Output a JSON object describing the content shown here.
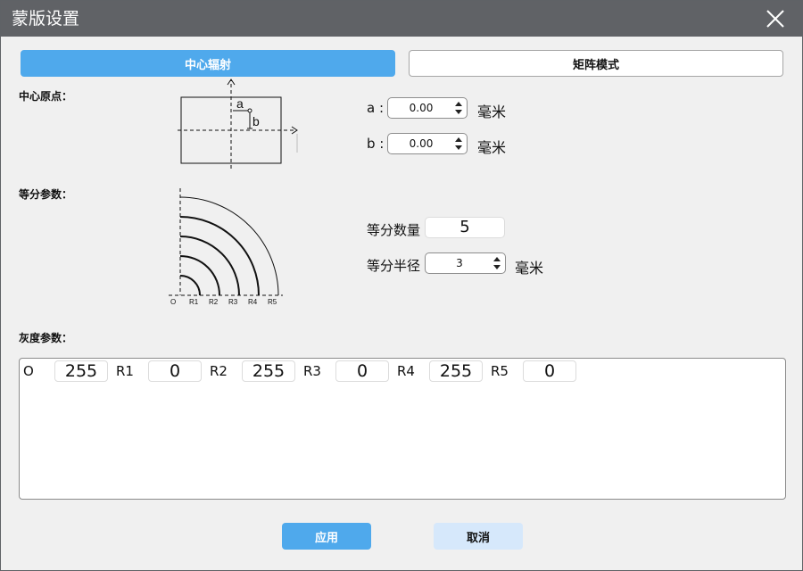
{
  "window": {
    "title": "蒙版设置"
  },
  "tabs": [
    {
      "label": "中心辐射",
      "active": true
    },
    {
      "label": "矩阵模式",
      "active": false
    }
  ],
  "center_origin": {
    "label": "中心原点：",
    "diagram": {
      "a_label": "a",
      "b_label": "b"
    },
    "a": {
      "label": "a :",
      "value": "0.00",
      "unit": "毫米"
    },
    "b": {
      "label": "b :",
      "value": "0.00",
      "unit": "毫米"
    }
  },
  "division": {
    "label": "等分参数：",
    "diagram": {
      "tick_labels": [
        "O",
        "R1",
        "R2",
        "R3",
        "R4",
        "R5"
      ]
    },
    "count": {
      "label": "等分数量",
      "value": "5"
    },
    "radius": {
      "label": "等分半径",
      "value": "3",
      "unit": "毫米"
    }
  },
  "gray": {
    "label": "灰度参数：",
    "items": [
      {
        "label": "O",
        "value": "255"
      },
      {
        "label": "R1",
        "value": "0"
      },
      {
        "label": "R2",
        "value": "255"
      },
      {
        "label": "R3",
        "value": "0"
      },
      {
        "label": "R4",
        "value": "255"
      },
      {
        "label": "R5",
        "value": "0"
      }
    ]
  },
  "buttons": {
    "apply": "应用",
    "cancel": "取消"
  },
  "colors": {
    "titlebar": "#606266",
    "accent": "#4fa9ec",
    "cancel_bg": "#d6e8fb",
    "background": "#f0f0f0"
  }
}
